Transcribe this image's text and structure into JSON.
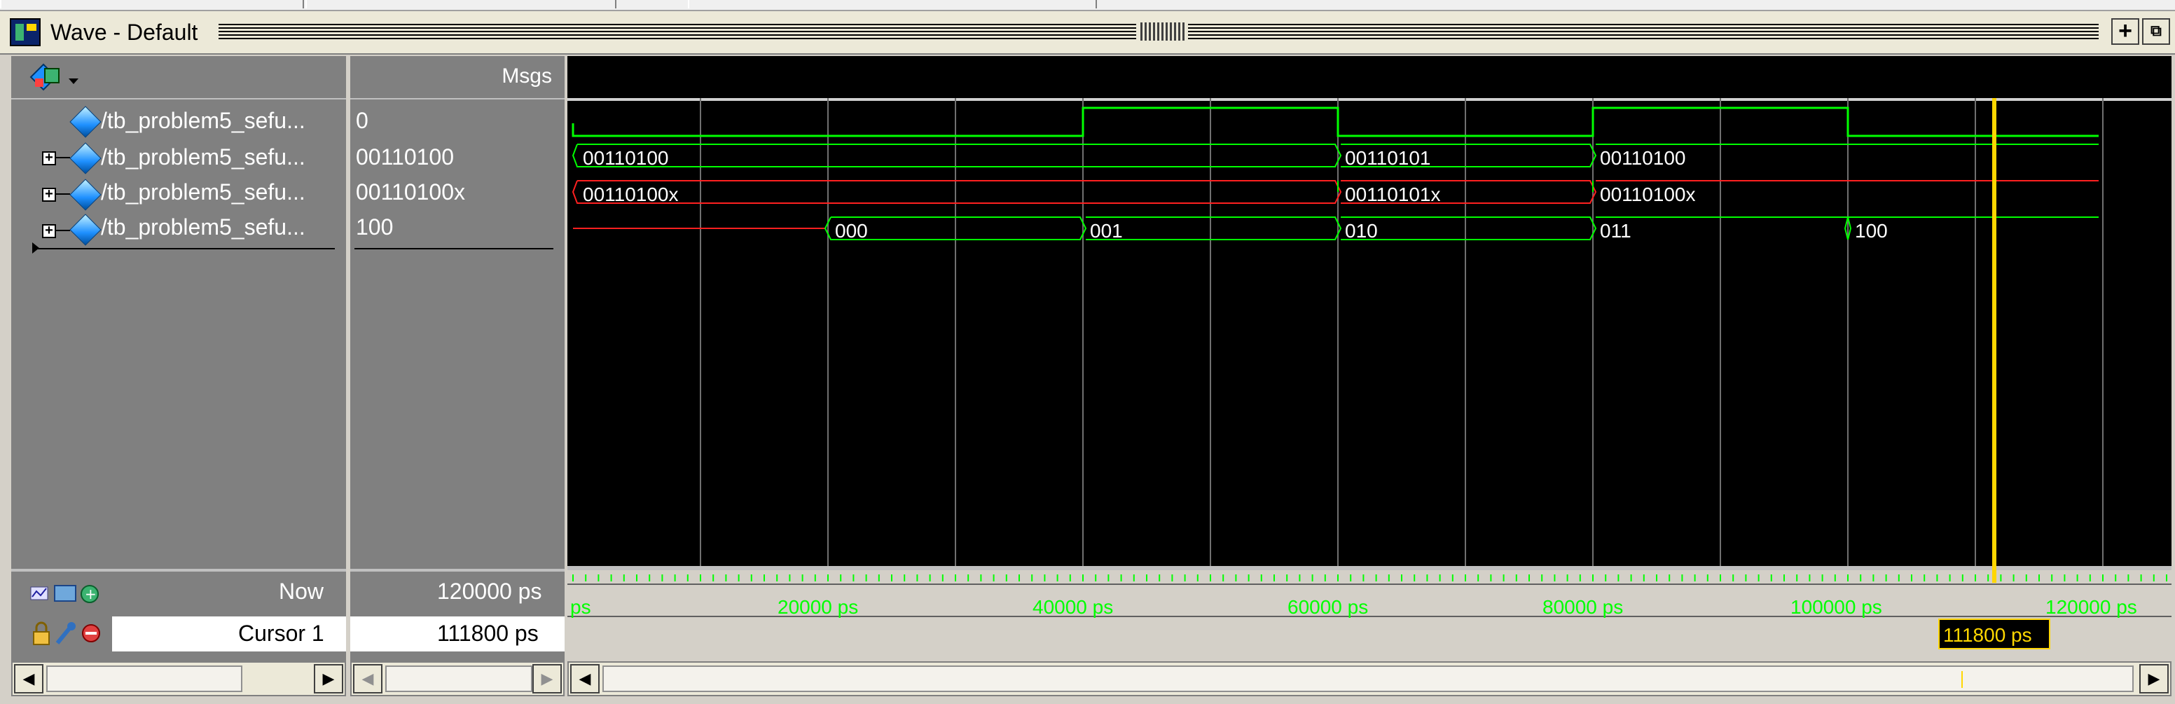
{
  "window": {
    "title": "Wave - Default"
  },
  "header": {
    "msgs_label": "Msgs"
  },
  "signals": [
    {
      "name": "/tb_problem5_sefu...",
      "value": "0",
      "expandable": false
    },
    {
      "name": "/tb_problem5_sefu...",
      "value": "00110100",
      "expandable": true
    },
    {
      "name": "/tb_problem5_sefu...",
      "value": "00110100x",
      "expandable": true
    },
    {
      "name": "/tb_problem5_sefu...",
      "value": "100",
      "expandable": true
    }
  ],
  "wave": {
    "bus1": [
      "00110100",
      "00110101",
      "00110100"
    ],
    "bus2": [
      "00110100x",
      "00110101x",
      "00110100x"
    ],
    "bus3": [
      "000",
      "001",
      "010",
      "011",
      "100"
    ]
  },
  "timeline": {
    "ticks": [
      "ps",
      "20000 ps",
      "40000 ps",
      "60000 ps",
      "80000 ps",
      "100000 ps",
      "120000 ps"
    ]
  },
  "status": {
    "now_label": "Now",
    "now_value": "120000 ps",
    "cursor_label": "Cursor 1",
    "cursor_value": "111800 ps",
    "cursor_tag": "111800 ps"
  },
  "colors": {
    "wave_green": "#00ff00",
    "wave_red": "#ff2020",
    "cursor_yellow": "#ffd700",
    "grid": "#808080"
  },
  "icons": {
    "app": "wave-window-icon",
    "palette": "signal-palette-icon",
    "signal": "diamond-signal-icon",
    "expand": "plus-expand-icon",
    "dock": "dock-icon",
    "undock": "undock-icon",
    "now_icons": [
      "wave-edit-icon",
      "monitor-icon",
      "add-cursor-icon"
    ],
    "cursor_icons": [
      "lock-icon",
      "wrench-icon",
      "remove-cursor-icon"
    ]
  }
}
